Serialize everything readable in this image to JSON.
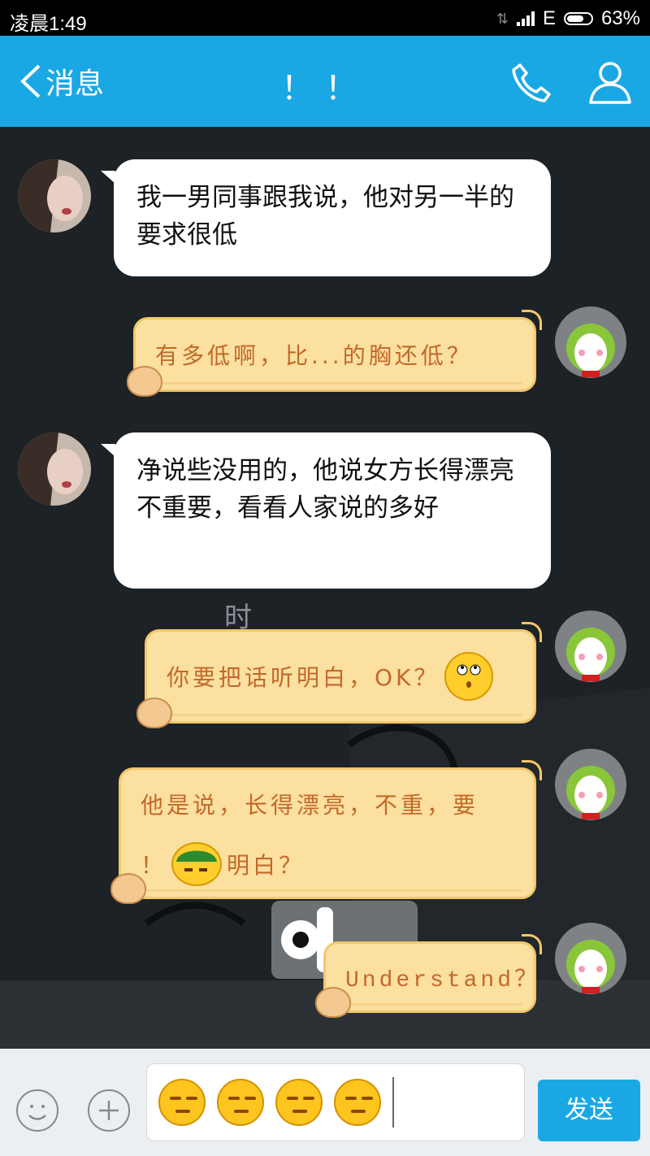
{
  "status_bar": {
    "time": "凌晨1:49",
    "network": "E",
    "battery": "63%",
    "data_icon": "data-transfer-icon"
  },
  "header": {
    "back_label": "消息",
    "title": "！！",
    "icons": [
      "phone-icon",
      "person-icon"
    ]
  },
  "messages": [
    {
      "side": "left",
      "text": "我一男同事跟我说，他对另一半的要求很低"
    },
    {
      "side": "right",
      "text": "有多低啊，比...的胸还低？"
    },
    {
      "side": "left",
      "text": "净说些没用的，他说女方长得漂亮不重要，看看人家说的多好"
    },
    {
      "side": "right",
      "text": "你要把话听明白，OK？",
      "emoji": "eyes-up-emoji"
    },
    {
      "side": "right",
      "text_a": "他是说，长得漂亮，不重，要",
      "text_b": "！",
      "text_c": "明白？",
      "emoji": "soldier-emoji"
    },
    {
      "side": "right",
      "text": "Understand？"
    }
  ],
  "background_text": "时",
  "input_bar": {
    "emojis": [
      "smirk-emoji",
      "smirk-emoji",
      "smirk-emoji",
      "smirk-emoji"
    ],
    "send_label": "发送"
  },
  "colors": {
    "accent": "#1aa8e4",
    "yellow_bubble": "#fbe0a0",
    "yellow_text": "#c2692a",
    "chat_bg": "#1d2226"
  }
}
